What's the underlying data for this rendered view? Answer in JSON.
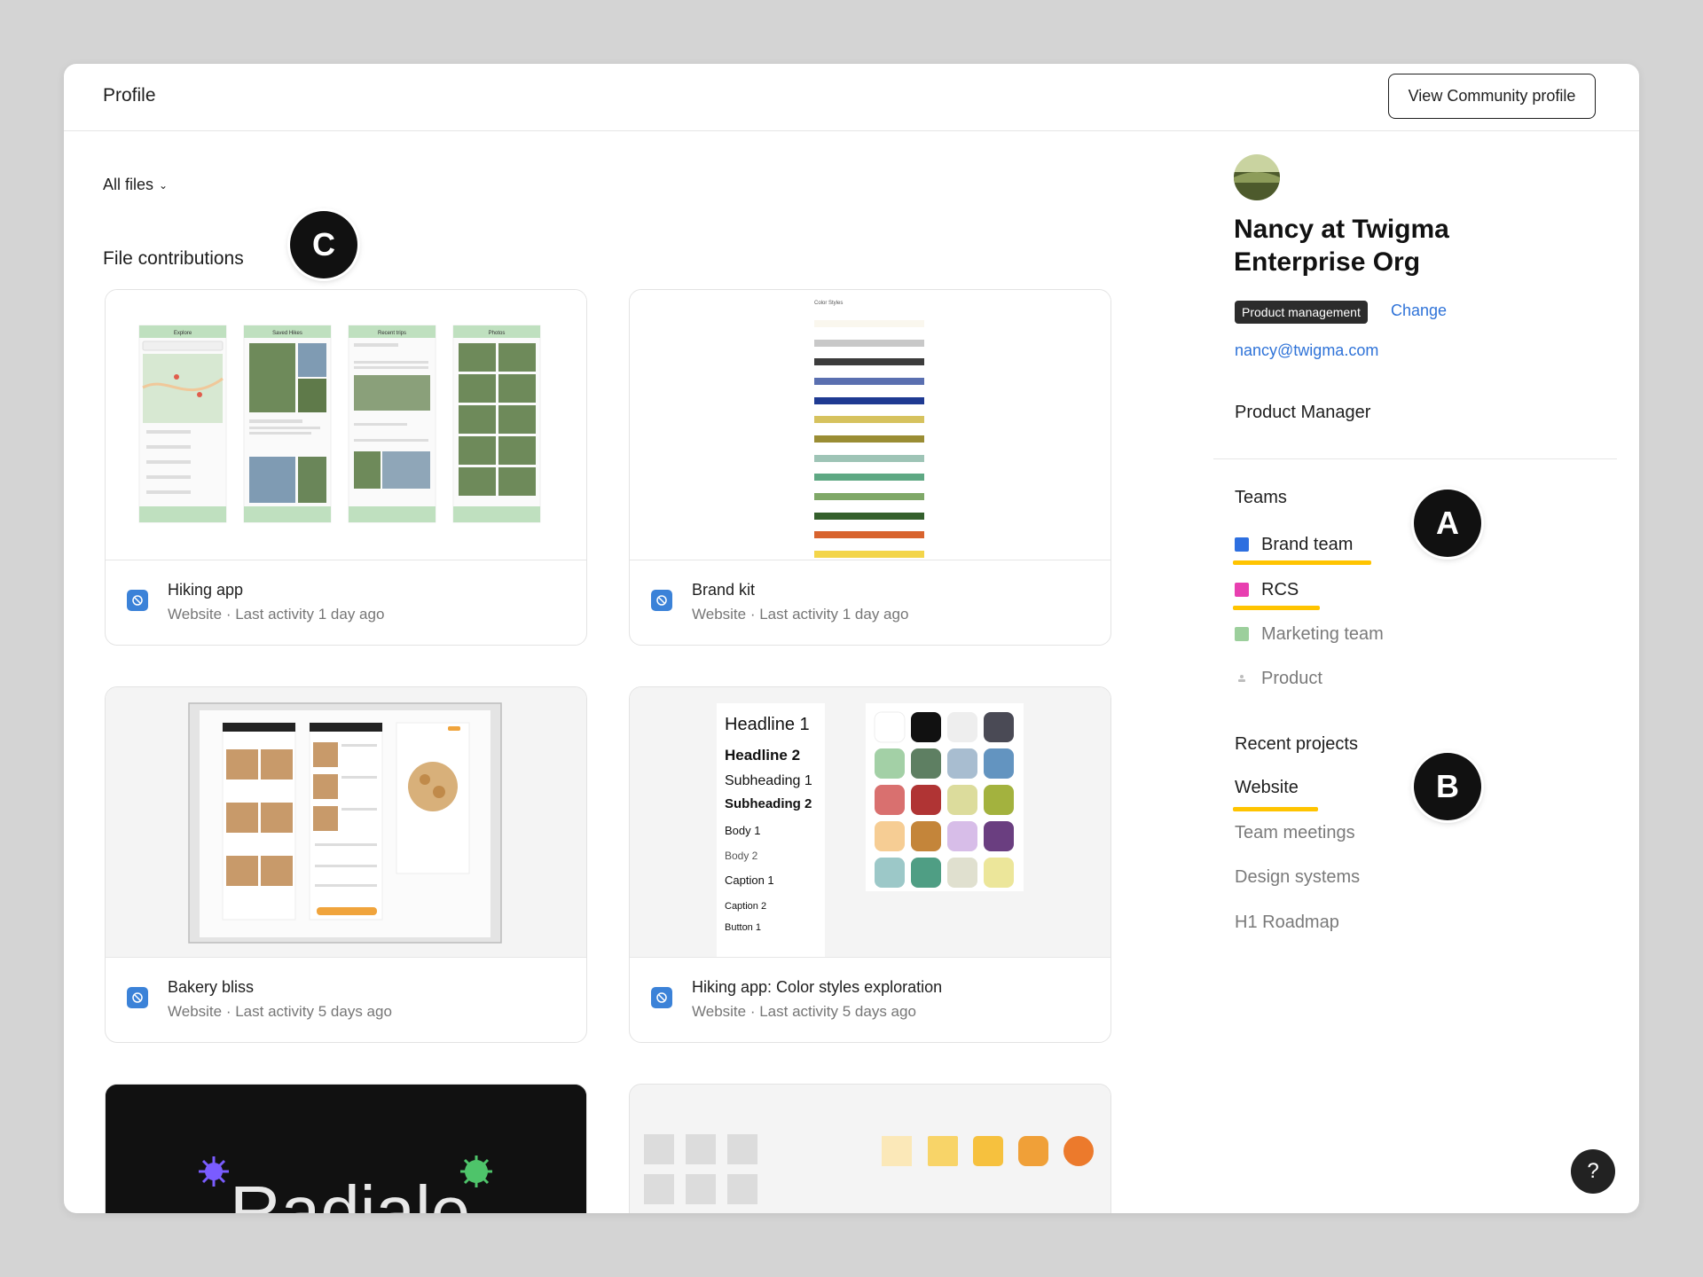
{
  "header": {
    "title": "Profile",
    "view_button": "View Community profile"
  },
  "filter": {
    "label": "All files"
  },
  "section": {
    "title": "File contributions"
  },
  "markers": {
    "a": "A",
    "b": "B",
    "c": "C"
  },
  "files": [
    {
      "name": "Hiking app",
      "meta": "Website · Last activity 1 day ago"
    },
    {
      "name": "Brand kit",
      "meta": "Website · Last activity 1 day ago"
    },
    {
      "name": "Bakery bliss",
      "meta": "Website · Last activity 5 days ago"
    },
    {
      "name": "Hiking app: Color styles exploration",
      "meta": "Website · Last activity 5 days ago"
    }
  ],
  "thumbs": {
    "hiking_screens": [
      "Explore",
      "Saved Hikes",
      "Recent trips",
      "Photos"
    ],
    "brand_kit_title": "Color Styles",
    "typography": [
      "Headline 1",
      "Headline 2",
      "Subheading 1",
      "Subheading 2",
      "Body 1",
      "Body 2",
      "Caption 1",
      "Caption 2",
      "Button 1"
    ],
    "radiale_word": "Radiale"
  },
  "profile": {
    "name": "Nancy at Twigma Enterprise Org",
    "role_badge": "Product management",
    "change_label": "Change",
    "email": "nancy@twigma.com",
    "job_title": "Product Manager"
  },
  "teams": {
    "heading": "Teams",
    "items": [
      {
        "label": "Brand team",
        "color": "#2d6fe0"
      },
      {
        "label": "RCS",
        "color": "#e83fb0"
      },
      {
        "label": "Marketing team",
        "color": "#9ccf9c"
      },
      {
        "label": "Product",
        "color": "#bdbdbd"
      }
    ]
  },
  "projects": {
    "heading": "Recent projects",
    "items": [
      "Website",
      "Team meetings",
      "Design systems",
      "H1 Roadmap"
    ]
  },
  "help": {
    "label": "?"
  },
  "colors": {
    "accent_link": "#2f73d8",
    "highlight_underline": "#ffc400",
    "file_icon": "#3b82d8"
  }
}
